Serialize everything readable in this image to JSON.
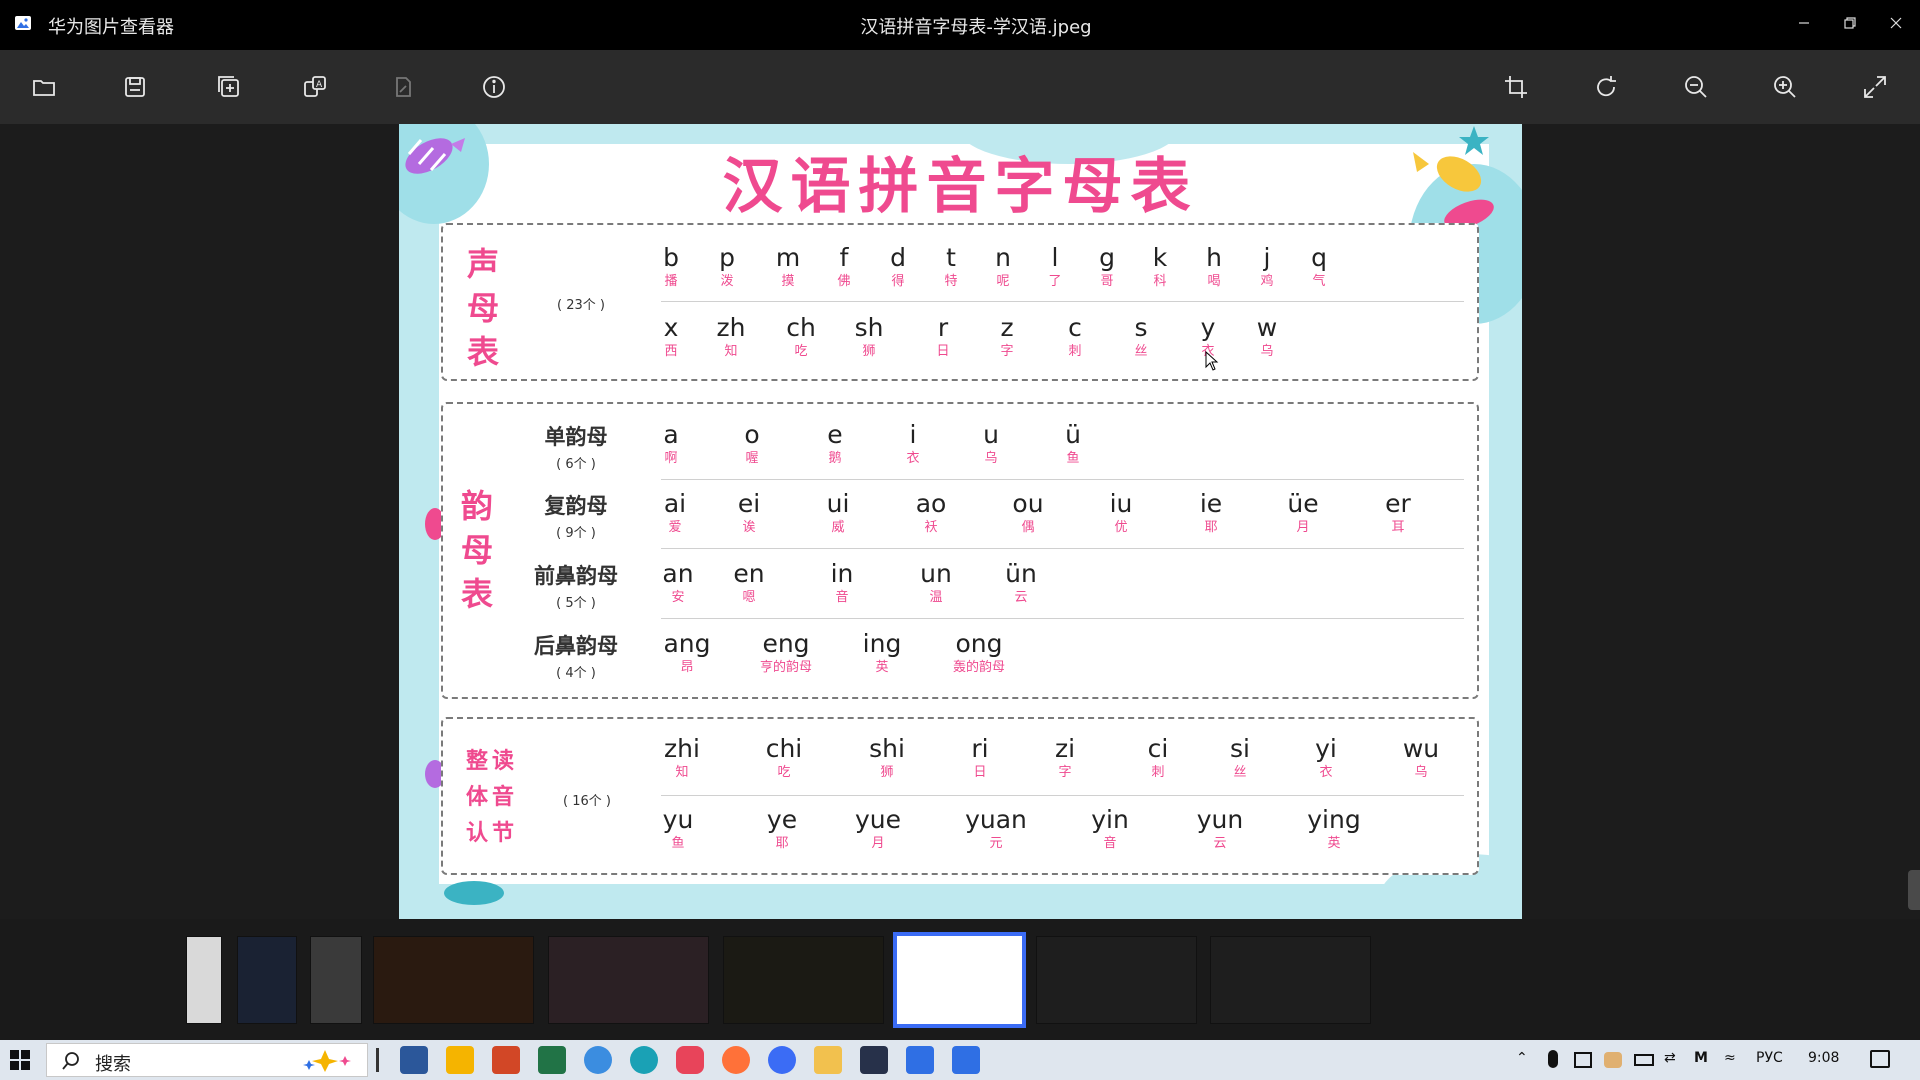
{
  "window": {
    "app_name": "华为图片查看器",
    "file_name": "汉语拼音字母表-学汉语.jpeg"
  },
  "toolbar_left": [
    "folder-icon",
    "save-icon",
    "add-icon",
    "translate-icon",
    "edit-icon",
    "info-icon"
  ],
  "toolbar_right": [
    "crop-icon",
    "rotate-icon",
    "zoom-out-icon",
    "zoom-in-icon",
    "fullscreen-icon"
  ],
  "poster": {
    "title": "汉语拼音字母表",
    "shengmu": {
      "side_title": "声母表",
      "count": "( 23个 )",
      "row1": [
        {
          "py": "b",
          "hz": "播"
        },
        {
          "py": "p",
          "hz": "泼"
        },
        {
          "py": "m",
          "hz": "摸"
        },
        {
          "py": "f",
          "hz": "佛"
        },
        {
          "py": "d",
          "hz": "得"
        },
        {
          "py": "t",
          "hz": "特"
        },
        {
          "py": "n",
          "hz": "呢"
        },
        {
          "py": "l",
          "hz": "了"
        },
        {
          "py": "g",
          "hz": "哥"
        },
        {
          "py": "k",
          "hz": "科"
        },
        {
          "py": "h",
          "hz": "喝"
        },
        {
          "py": "j",
          "hz": "鸡"
        },
        {
          "py": "q",
          "hz": "气"
        }
      ],
      "row2": [
        {
          "py": "x",
          "hz": "西"
        },
        {
          "py": "zh",
          "hz": "知"
        },
        {
          "py": "ch",
          "hz": "吃"
        },
        {
          "py": "sh",
          "hz": "狮"
        },
        {
          "py": "r",
          "hz": "日"
        },
        {
          "py": "z",
          "hz": "字"
        },
        {
          "py": "c",
          "hz": "刺"
        },
        {
          "py": "s",
          "hz": "丝"
        },
        {
          "py": "y",
          "hz": "衣"
        },
        {
          "py": "w",
          "hz": "乌"
        }
      ]
    },
    "yunmu": {
      "side_title": "韵母表",
      "groups": [
        {
          "label": "单韵母",
          "count": "( 6个 )",
          "items": [
            {
              "py": "a",
              "hz": "啊"
            },
            {
              "py": "o",
              "hz": "喔"
            },
            {
              "py": "e",
              "hz": "鹅"
            },
            {
              "py": "i",
              "hz": "衣"
            },
            {
              "py": "u",
              "hz": "乌"
            },
            {
              "py": "ü",
              "hz": "鱼"
            }
          ]
        },
        {
          "label": "复韵母",
          "count": "( 9个 )",
          "items": [
            {
              "py": "ai",
              "hz": "爱"
            },
            {
              "py": "ei",
              "hz": "诶"
            },
            {
              "py": "ui",
              "hz": "威"
            },
            {
              "py": "ao",
              "hz": "袄"
            },
            {
              "py": "ou",
              "hz": "偶"
            },
            {
              "py": "iu",
              "hz": "优"
            },
            {
              "py": "ie",
              "hz": "耶"
            },
            {
              "py": "üe",
              "hz": "月"
            },
            {
              "py": "er",
              "hz": "耳"
            }
          ]
        },
        {
          "label": "前鼻韵母",
          "count": "( 5个 )",
          "items": [
            {
              "py": "an",
              "hz": "安"
            },
            {
              "py": "en",
              "hz": "嗯"
            },
            {
              "py": "in",
              "hz": "音"
            },
            {
              "py": "un",
              "hz": "温"
            },
            {
              "py": "ün",
              "hz": "云"
            }
          ]
        },
        {
          "label": "后鼻韵母",
          "count": "( 4个 )",
          "items": [
            {
              "py": "ang",
              "hz": "昂"
            },
            {
              "py": "eng",
              "hz": "亨的韵母"
            },
            {
              "py": "ing",
              "hz": "英"
            },
            {
              "py": "ong",
              "hz": "轰的韵母"
            }
          ]
        }
      ]
    },
    "zhengti": {
      "side_title": [
        "整读",
        "体音",
        "认节"
      ],
      "count": "( 16个 )",
      "row1": [
        {
          "py": "zhi",
          "hz": "知"
        },
        {
          "py": "chi",
          "hz": "吃"
        },
        {
          "py": "shi",
          "hz": "狮"
        },
        {
          "py": "ri",
          "hz": "日"
        },
        {
          "py": "zi",
          "hz": "字"
        },
        {
          "py": "ci",
          "hz": "刺"
        },
        {
          "py": "si",
          "hz": "丝"
        },
        {
          "py": "yi",
          "hz": "衣"
        },
        {
          "py": "wu",
          "hz": "乌"
        }
      ],
      "row2": [
        {
          "py": "yu",
          "hz": "鱼"
        },
        {
          "py": "ye",
          "hz": "耶"
        },
        {
          "py": "yue",
          "hz": "月"
        },
        {
          "py": "yuan",
          "hz": "元"
        },
        {
          "py": "yin",
          "hz": "音"
        },
        {
          "py": "yun",
          "hz": "云"
        },
        {
          "py": "ying",
          "hz": "英"
        }
      ]
    }
  },
  "filmstrip": {
    "thumbs": [
      {
        "color": "#d9d9d9"
      },
      {
        "color": "#1a2233"
      },
      {
        "color": "#3a3a3a"
      },
      {
        "color": "#2a1a10"
      },
      {
        "color": "#2b2024"
      },
      {
        "color": "#1b1a14"
      },
      {
        "color": "#ffffff"
      },
      {
        "color": "#1e1e1e"
      },
      {
        "color": "#1e1e1e"
      }
    ]
  },
  "taskbar": {
    "search_placeholder": "搜索",
    "language": "РУС",
    "time": "9:08"
  }
}
